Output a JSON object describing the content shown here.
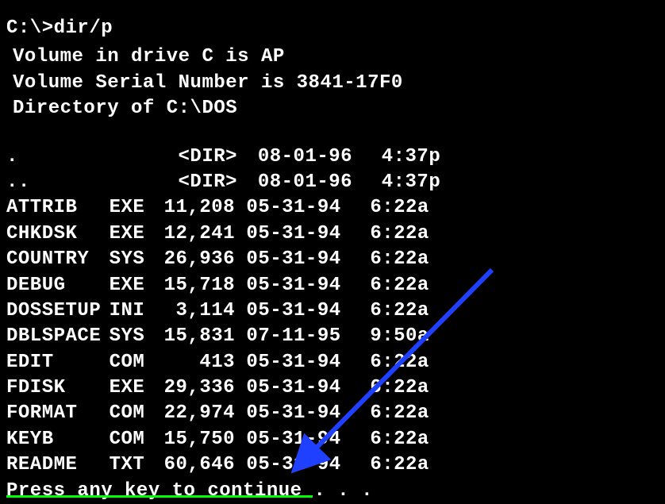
{
  "prompt": "C:\\>dir/p",
  "header": {
    "volume": "Volume in drive C is AP",
    "serial": "Volume Serial Number is 3841-17F0",
    "dirof": "Directory of C:\\DOS"
  },
  "entries": [
    {
      "name": ".",
      "ext": "",
      "size": "<DIR>",
      "date": "08-01-96",
      "time": "4:37p"
    },
    {
      "name": "..",
      "ext": "",
      "size": "<DIR>",
      "date": "08-01-96",
      "time": "4:37p"
    },
    {
      "name": "ATTRIB",
      "ext": "EXE",
      "size": "11,208",
      "date": "05-31-94",
      "time": "6:22a"
    },
    {
      "name": "CHKDSK",
      "ext": "EXE",
      "size": "12,241",
      "date": "05-31-94",
      "time": "6:22a"
    },
    {
      "name": "COUNTRY",
      "ext": "SYS",
      "size": "26,936",
      "date": "05-31-94",
      "time": "6:22a"
    },
    {
      "name": "DEBUG",
      "ext": "EXE",
      "size": "15,718",
      "date": "05-31-94",
      "time": "6:22a"
    },
    {
      "name": "DOSSETUP",
      "ext": "INI",
      "size": "3,114",
      "date": "05-31-94",
      "time": "6:22a"
    },
    {
      "name": "DBLSPACE",
      "ext": "SYS",
      "size": "15,831",
      "date": "07-11-95",
      "time": "9:50a"
    },
    {
      "name": "EDIT",
      "ext": "COM",
      "size": "413",
      "date": "05-31-94",
      "time": "6:22a"
    },
    {
      "name": "FDISK",
      "ext": "EXE",
      "size": "29,336",
      "date": "05-31-94",
      "time": "6:22a"
    },
    {
      "name": "FORMAT",
      "ext": "COM",
      "size": "22,974",
      "date": "05-31-94",
      "time": "6:22a"
    },
    {
      "name": "KEYB",
      "ext": "COM",
      "size": "15,750",
      "date": "05-31-94",
      "time": "6:22a"
    },
    {
      "name": "README",
      "ext": "TXT",
      "size": "60,646",
      "date": "05-31-94",
      "time": "6:22a"
    }
  ],
  "footer": "Press any key to continue . . ."
}
